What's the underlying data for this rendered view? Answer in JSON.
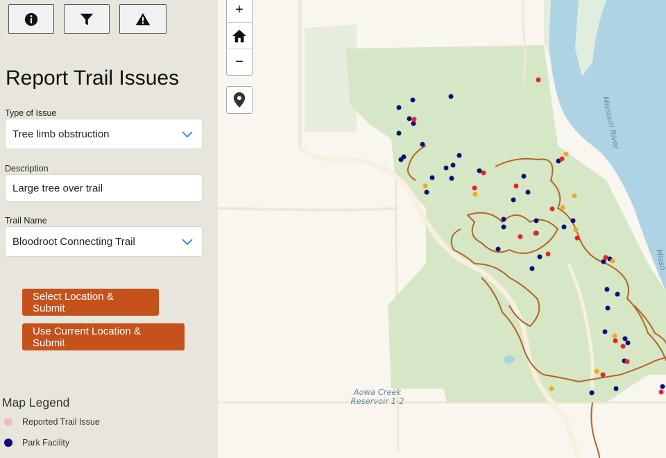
{
  "toolbar": {
    "info_icon": "info-circle-icon",
    "filter_icon": "filter-icon",
    "alert_icon": "warning-triangle-icon"
  },
  "form": {
    "title": "Report Trail Issues",
    "type_label": "Type of Issue",
    "type_value": "Tree limb obstruction",
    "description_label": "Description",
    "description_value": "Large tree over trail",
    "trail_label": "Trail Name",
    "trail_value": "Bloodroot Connecting Trail",
    "select_location_button": "Select Location & Submit",
    "current_location_button": "Use Current Location & Submit"
  },
  "legend": {
    "title": "Map Legend",
    "items": [
      {
        "label": "Reported Trail Issue",
        "color": "#f4b8c0"
      },
      {
        "label": "Park Facility",
        "color": "#0e0e7a"
      }
    ]
  },
  "map_controls": {
    "zoom_in": "+",
    "home_icon": "home-icon",
    "zoom_out": "−",
    "locate_icon": "map-marker-icon"
  },
  "map_labels": {
    "river": "Missouri River",
    "river_edge": "Misso",
    "reservoir_line1": "Aowa Creek",
    "reservoir_line2": "Reservoir 1-2"
  },
  "colors": {
    "issue_red": "#e8232a",
    "issue_orange": "#f5a623",
    "facility_blue": "#0e0e7a",
    "trail_brown": "#b5632a",
    "park_green": "#d6e8c4",
    "water": "#aed3e4",
    "accent_button": "#c4521a"
  }
}
